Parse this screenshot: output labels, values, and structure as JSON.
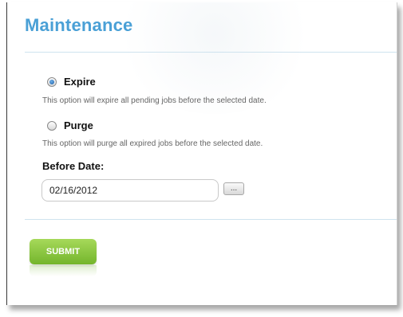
{
  "page": {
    "title": "Maintenance"
  },
  "options": [
    {
      "label": "Expire",
      "checked": true,
      "description": "This option will expire all pending jobs before the selected date."
    },
    {
      "label": "Purge",
      "checked": false,
      "description": "This option will purge all expired jobs before the selected date."
    }
  ],
  "before_date": {
    "label": "Before Date:",
    "value": "02/16/2012",
    "picker_label": "..."
  },
  "submit": {
    "label": "SUBMIT"
  },
  "colors": {
    "title": "#4aa0d6",
    "submit": "#8cc63f"
  }
}
